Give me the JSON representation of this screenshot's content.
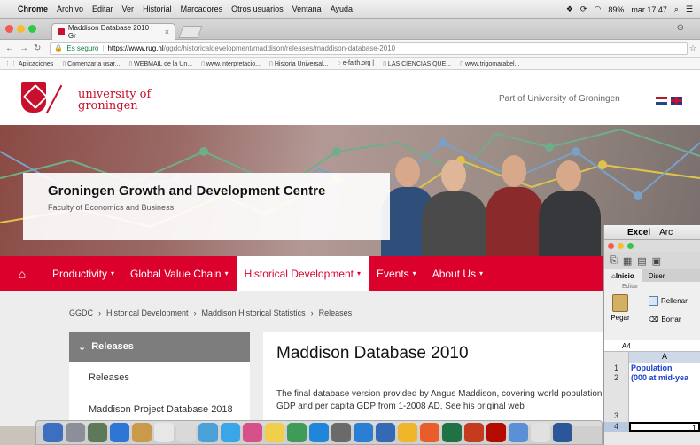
{
  "menubar": {
    "app": "Chrome",
    "items": [
      "Archivo",
      "Editar",
      "Ver",
      "Historial",
      "Marcadores",
      "Otros usuarios",
      "Ventana",
      "Ayuda"
    ],
    "battery": "89%",
    "clock": "mar 17:47"
  },
  "chrome": {
    "tab_title": "Maddison Database 2010 | Gr",
    "secure_label": "Es seguro",
    "url_host": "https://www.rug.nl",
    "url_path": "/ggdc/historicaldevelopment/maddison/releases/maddison-database-2010",
    "bookmarks": [
      "Aplicaciones",
      "Comenzar a usar...",
      "WEBMAIL de la Un...",
      "www.interpretacio...",
      "Historia Universal...",
      "e-faith.org |",
      "LAS CIENCIAS QUE...",
      "www.trigomarabel..."
    ]
  },
  "site": {
    "uni_line1": "university of",
    "uni_line2": "groningen",
    "part_of": "Part of University of Groningen",
    "hero_title": "Groningen Growth and Development Centre",
    "hero_sub": "Faculty of Economics and Business",
    "nav": {
      "productivity": "Productivity",
      "gvc": "Global Value Chain",
      "historical": "Historical Development",
      "events": "Events",
      "about": "About Us"
    },
    "breadcrumb": [
      "GGDC",
      "Historical Development",
      "Maddison Historical Statistics",
      "Releases"
    ],
    "sidebar": {
      "head": "Releases",
      "items": [
        "Releases",
        "Maddison Project Database 2018"
      ]
    },
    "main_title": "Maddison Database 2010",
    "main_text": "The final database version provided by Angus Maddison, covering world population, GDP and per capita GDP from 1-2008 AD. See his original web"
  },
  "excel": {
    "app": "Excel",
    "menu2": "Arc",
    "tabs": [
      "Inicio",
      "Diser"
    ],
    "group": "Editar",
    "paste": "Pegar",
    "fill": "Rellenar",
    "clear": "Borrar",
    "namebox": "A4",
    "col": "A",
    "rows": [
      {
        "n": "1",
        "v": "Population"
      },
      {
        "n": "2",
        "v": "(000 at mid-yea"
      },
      {
        "n": "3",
        "v": ""
      },
      {
        "n": "4",
        "v": "1"
      }
    ]
  },
  "colors": {
    "brand_red": "#dc002d",
    "excel_text": "#1a3ec7"
  }
}
